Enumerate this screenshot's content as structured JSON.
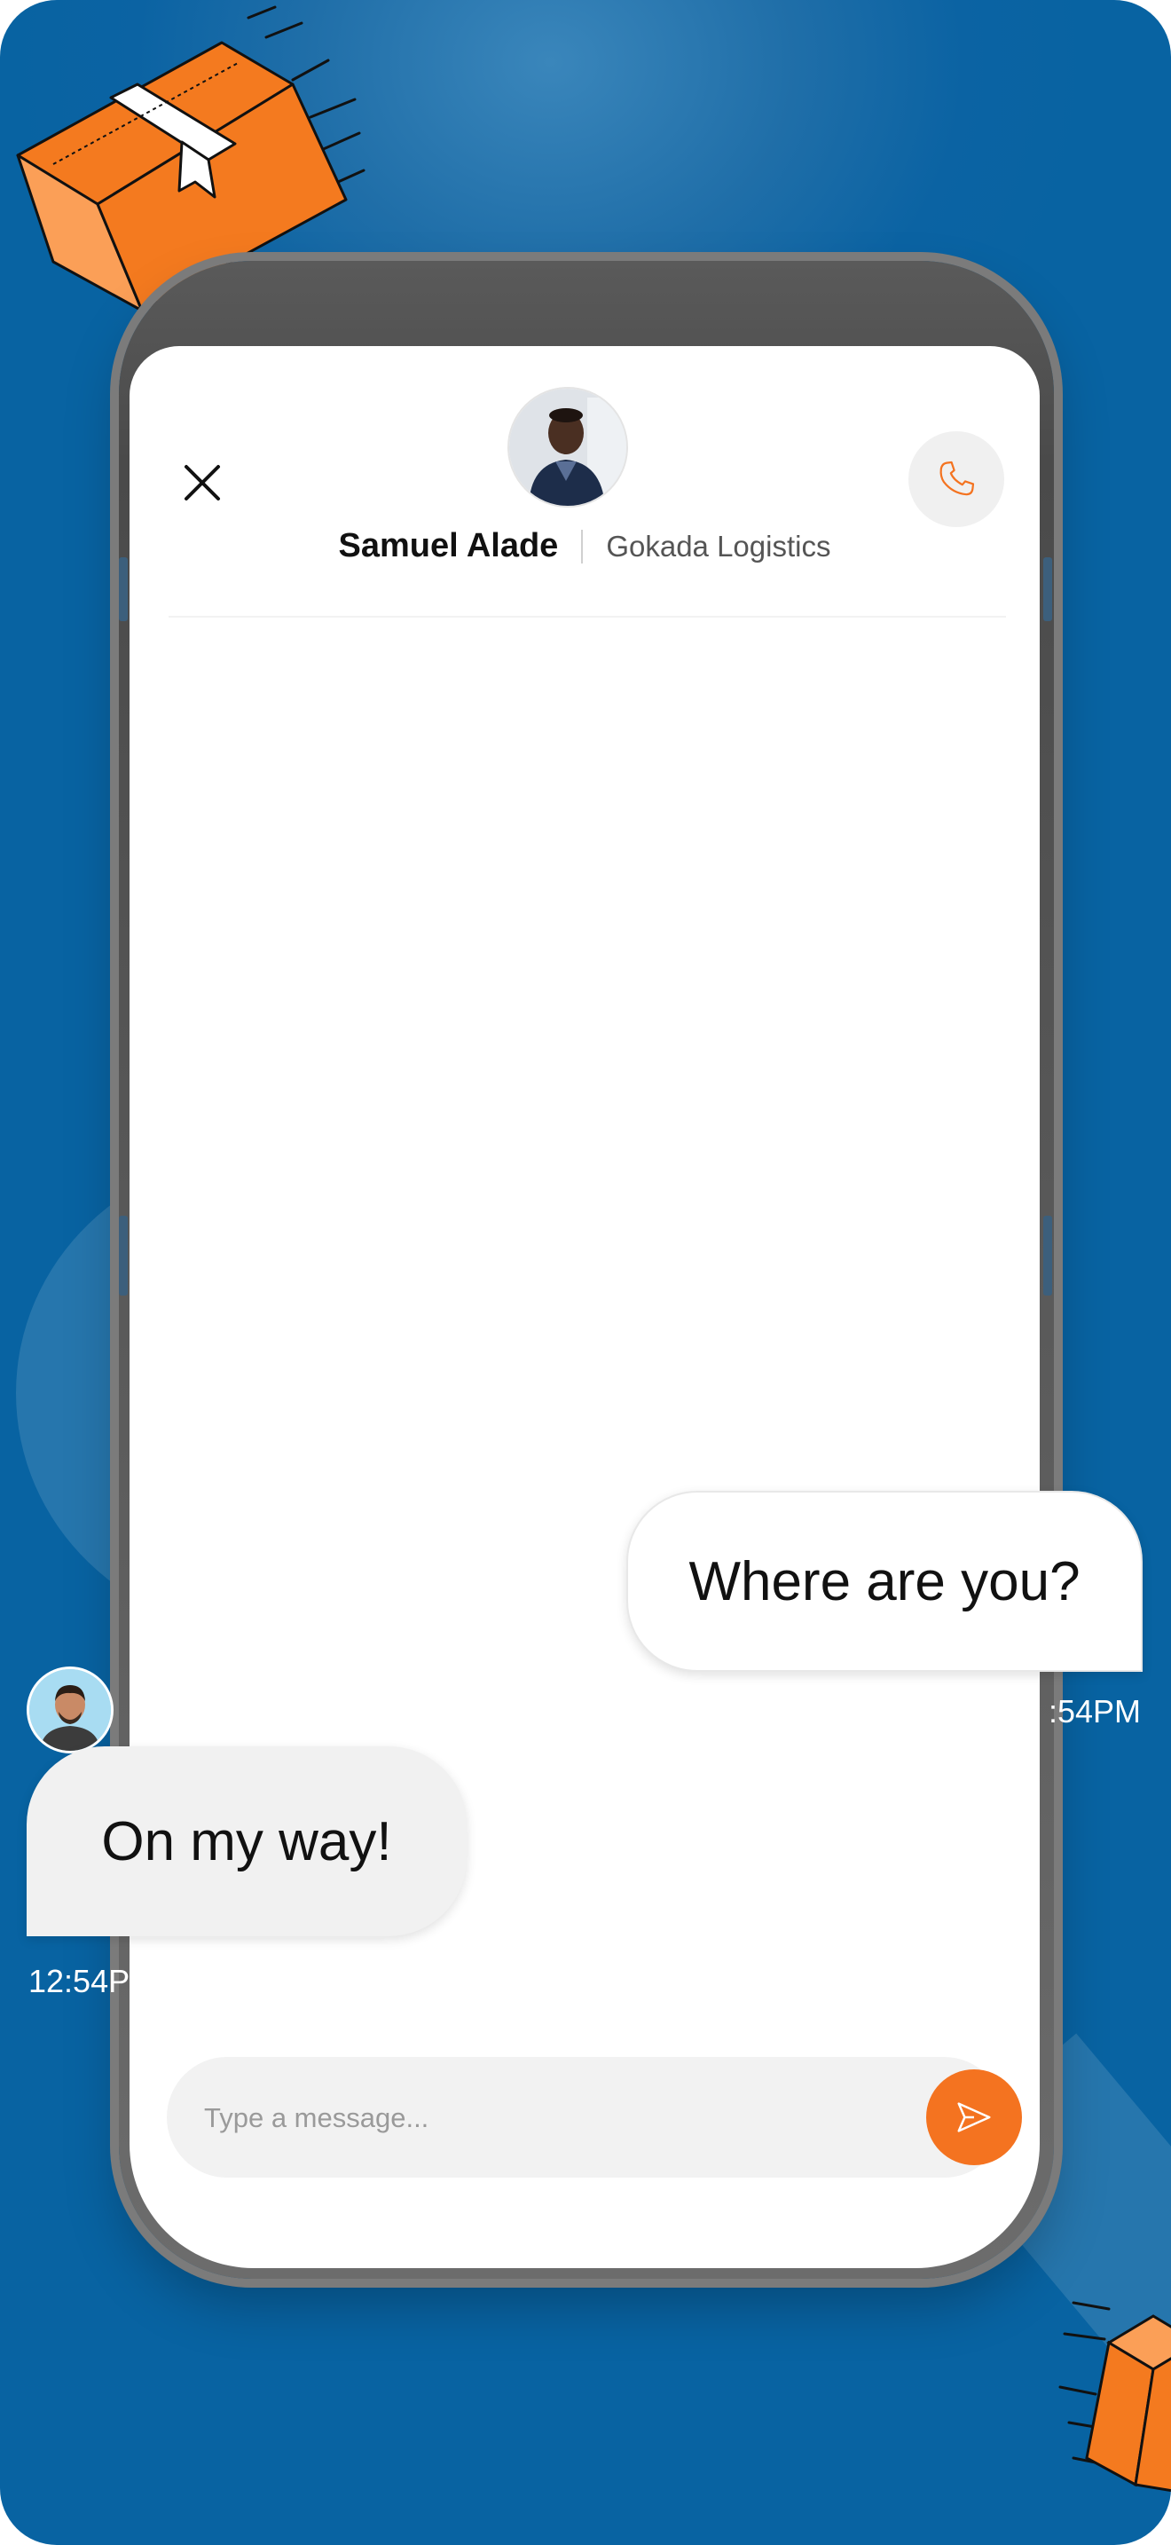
{
  "contact": {
    "name": "Samuel Alade",
    "company": "Gokada Logistics",
    "avatar_icon": "person-photo-icon"
  },
  "header": {
    "close_icon": "close-icon",
    "call_icon": "phone-icon"
  },
  "messages": [
    {
      "direction": "outgoing",
      "text": "Where are you?",
      "time": ":54PM"
    },
    {
      "direction": "incoming",
      "text": "On my way!",
      "time": "12:54P"
    }
  ],
  "composer": {
    "placeholder": "Type a message...",
    "send_icon": "send-icon"
  },
  "colors": {
    "background": "#0863a2",
    "accent": "#f47320",
    "composer_bg": "#f2f2f2"
  }
}
